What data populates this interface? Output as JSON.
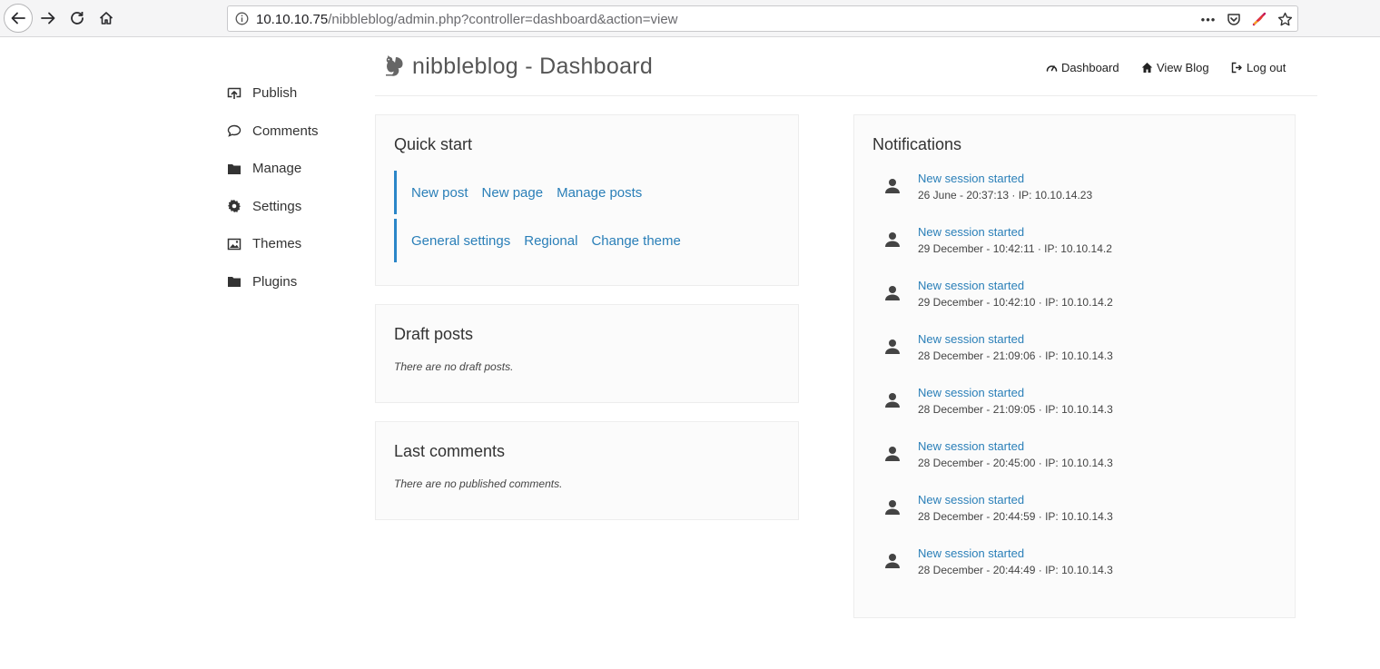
{
  "browser": {
    "url_host": "10.10.10.75",
    "url_path": "/nibbleblog/admin.php?controller=dashboard&action=view",
    "more_label": "•••"
  },
  "sidebar": {
    "items": [
      {
        "label": "Publish",
        "icon": "publish-icon"
      },
      {
        "label": "Comments",
        "icon": "comment-icon"
      },
      {
        "label": "Manage",
        "icon": "folder-icon"
      },
      {
        "label": "Settings",
        "icon": "gear-icon"
      },
      {
        "label": "Themes",
        "icon": "image-icon"
      },
      {
        "label": "Plugins",
        "icon": "folder-icon"
      }
    ]
  },
  "header": {
    "title": "nibbleblog - Dashboard",
    "links": {
      "dashboard": "Dashboard",
      "view_blog": "View Blog",
      "logout": "Log out"
    }
  },
  "quick_start": {
    "title": "Quick start",
    "row1": [
      "New post",
      "New page",
      "Manage posts"
    ],
    "row2": [
      "General settings",
      "Regional",
      "Change theme"
    ]
  },
  "draft_posts": {
    "title": "Draft posts",
    "empty": "There are no draft posts."
  },
  "last_comments": {
    "title": "Last comments",
    "empty": "There are no published comments."
  },
  "notifications": {
    "title": "Notifications",
    "items": [
      {
        "title": "New session started",
        "meta": "26 June - 20:37:13 · IP: 10.10.14.23"
      },
      {
        "title": "New session started",
        "meta": "29 December - 10:42:11 · IP: 10.10.14.2"
      },
      {
        "title": "New session started",
        "meta": "29 December - 10:42:10 · IP: 10.10.14.2"
      },
      {
        "title": "New session started",
        "meta": "28 December - 21:09:06 · IP: 10.10.14.3"
      },
      {
        "title": "New session started",
        "meta": "28 December - 21:09:05 · IP: 10.10.14.3"
      },
      {
        "title": "New session started",
        "meta": "28 December - 20:45:00 · IP: 10.10.14.3"
      },
      {
        "title": "New session started",
        "meta": "28 December - 20:44:59 · IP: 10.10.14.3"
      },
      {
        "title": "New session started",
        "meta": "28 December - 20:44:49 · IP: 10.10.14.3"
      }
    ]
  },
  "colors": {
    "link": "#2a7fb8",
    "accent_bar": "#2a86c8"
  }
}
